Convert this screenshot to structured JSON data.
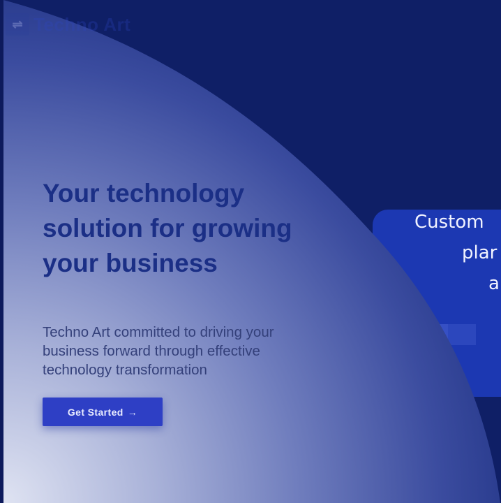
{
  "brand": {
    "name": "Techno Art",
    "icon": "techno-art-logo-icon"
  },
  "hero": {
    "title": "Your technology solution for growing your business",
    "subtitle": "Techno Art committed to driving your business forward through effective technology transformation",
    "cta_label": "Get Started",
    "cta_icon": "arrow-right-icon"
  },
  "slide_text": {
    "line1": "Custom",
    "line2": "plar",
    "line3": "a"
  },
  "colors": {
    "background": "#0f1f66",
    "accent": "#2e3fc5",
    "title": "#1b2f86"
  }
}
